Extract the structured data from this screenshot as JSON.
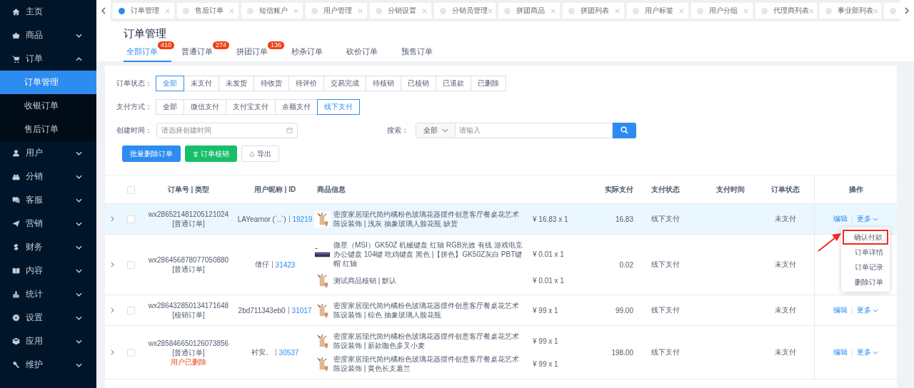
{
  "sidebar": {
    "items": [
      {
        "label": "主页",
        "kind": "link"
      },
      {
        "label": "商品",
        "kind": "group",
        "expanded": false
      },
      {
        "label": "订单",
        "kind": "group",
        "expanded": true,
        "children": [
          {
            "label": "订单管理",
            "selected": true
          },
          {
            "label": "收银订单",
            "selected": false
          },
          {
            "label": "售后订单",
            "selected": false
          }
        ]
      },
      {
        "label": "用户",
        "kind": "group",
        "expanded": false
      },
      {
        "label": "分销",
        "kind": "group",
        "expanded": false
      },
      {
        "label": "客服",
        "kind": "group",
        "expanded": false
      },
      {
        "label": "营销",
        "kind": "group",
        "expanded": false
      },
      {
        "label": "财务",
        "kind": "group",
        "expanded": false
      },
      {
        "label": "内容",
        "kind": "group",
        "expanded": false
      },
      {
        "label": "统计",
        "kind": "group",
        "expanded": false
      },
      {
        "label": "设置",
        "kind": "group",
        "expanded": false
      },
      {
        "label": "应用",
        "kind": "group",
        "expanded": false
      },
      {
        "label": "维护",
        "kind": "group",
        "expanded": false
      }
    ]
  },
  "tab_bar": {
    "tabs": [
      {
        "label": "订单管理",
        "selected": true
      },
      {
        "label": "售后订单",
        "selected": false
      },
      {
        "label": "短信账户",
        "selected": false
      },
      {
        "label": "用户管理",
        "selected": false
      },
      {
        "label": "分销设置",
        "selected": false
      },
      {
        "label": "分销员管理",
        "selected": false
      },
      {
        "label": "拼团商品",
        "selected": false
      },
      {
        "label": "拼团列表",
        "selected": false
      },
      {
        "label": "用户标签",
        "selected": false
      },
      {
        "label": "用户分组",
        "selected": false
      },
      {
        "label": "代理商列表",
        "selected": false
      },
      {
        "label": "事业部列表",
        "selected": false
      }
    ]
  },
  "page_title": "订单管理",
  "order_tabs": [
    {
      "label": "全部订单",
      "badge": "410",
      "selected": true
    },
    {
      "label": "普通订单",
      "badge": "274",
      "selected": false
    },
    {
      "label": "拼团订单",
      "badge": "136",
      "selected": false
    },
    {
      "label": "秒杀订单",
      "selected": false
    },
    {
      "label": "砍价订单",
      "selected": false
    },
    {
      "label": "预售订单",
      "selected": false
    }
  ],
  "filters": {
    "order_status": {
      "label": "订单状态：",
      "options": [
        {
          "label": "全部",
          "selected": true
        },
        {
          "label": "未支付",
          "selected": false
        },
        {
          "label": "未发货",
          "selected": false
        },
        {
          "label": "待收货",
          "selected": false
        },
        {
          "label": "待评价",
          "selected": false
        },
        {
          "label": "交易完成",
          "selected": false
        },
        {
          "label": "待核销",
          "selected": false
        },
        {
          "label": "已核销",
          "selected": false
        },
        {
          "label": "已退款",
          "selected": false
        },
        {
          "label": "已删除",
          "selected": false
        }
      ]
    },
    "payment": {
      "label": "支付方式：",
      "options": [
        {
          "label": "全部",
          "selected": false
        },
        {
          "label": "微信支付",
          "selected": false
        },
        {
          "label": "支付宝支付",
          "selected": false
        },
        {
          "label": "余额支付",
          "selected": false
        },
        {
          "label": "线下支付",
          "selected": true
        }
      ]
    },
    "created": {
      "label": "创建时间：",
      "placeholder": "请选择创建时间"
    },
    "search": {
      "label": "搜索：",
      "scope": "全部",
      "placeholder": "请输入"
    }
  },
  "actions": [
    {
      "label": "批量删除订单",
      "kind": "primary"
    },
    {
      "label": "订单核销",
      "kind": "success"
    },
    {
      "label": "导出",
      "kind": "plain"
    }
  ],
  "table": {
    "select_all_checked": false,
    "columns": [
      "订单号 | 类型",
      "用户昵称 | ID",
      "商品信息",
      "实际支付",
      "支付状态",
      "支付时间",
      "订单状态",
      "操作"
    ],
    "rows": [
      {
        "order_no": "wx286521481205121024",
        "type": "[普通订单]",
        "user": "LAYearnor (ˊ..ˋ)",
        "user_id": "19219",
        "items": [
          {
            "name": "密度家居现代简约橘粉色玻璃花器摆件创意客厅餐桌花艺术陈设装饰 | 浅灰 抽象玻璃人脸花瓶 缺货",
            "price": "¥ 16.83 x 1",
            "kind": "vase"
          }
        ],
        "paid": "16.83",
        "pay_status": "线下支付",
        "order_status": "未支付",
        "checked": false,
        "highlighted": true,
        "edit": "编辑",
        "more": "更多",
        "menu": [
          {
            "label": "确认付款",
            "highlighted": true
          },
          {
            "label": "订单详情",
            "highlighted": false
          },
          {
            "label": "订单记录",
            "highlighted": false
          },
          {
            "label": "删除订单",
            "highlighted": false
          }
        ]
      },
      {
        "order_no": "wx286456878077050880",
        "type": "[普通订单]",
        "user": "倩仔",
        "user_id": "31423",
        "items": [
          {
            "name": "微星（MSI）GK50Z 机械键盘 红轴 RGB光效 有线 游戏电竞办公键盘 104键 吃鸡键盘 黑色 |【拼色】GK50Z灰白 PBT键帽 红轴",
            "price": "¥ 0.01 x 1",
            "kind": "keyboard"
          },
          {
            "name": "测试商品核销 | 默认",
            "price": "¥ 0.01 x 1",
            "kind": "vase"
          }
        ],
        "paid": "0.02",
        "pay_status": "线下支付",
        "order_status": "未支付",
        "checked": false,
        "highlighted": false
      },
      {
        "order_no": "wx286432850134171648",
        "type": "[核销订单]",
        "user": "2bd711343eb0",
        "user_id": "31017",
        "items": [
          {
            "name": "密度家居现代简约橘粉色玻璃花器摆件创意客厅餐桌花艺术陈设装饰 | 棕色 抽象玻璃人脸花瓶",
            "price": "¥ 99 x 1",
            "kind": "vase"
          }
        ],
        "paid": "99.00",
        "pay_status": "线下支付",
        "order_status": "未支付",
        "checked": false,
        "highlighted": false,
        "edit": "编辑",
        "more": "更多"
      },
      {
        "order_no": "wx285846650126073856",
        "type": "[普通订单]",
        "note": "用户已删除",
        "user": "衬安。",
        "user_id": "30537",
        "items": [
          {
            "name": "密度家居现代简约橘粉色玻璃花器摆件创意客厅餐桌花艺术陈设装饰 | 新款咖色多叉小麦",
            "price": "¥ 99 x 1",
            "kind": "vase"
          },
          {
            "name": "密度家居现代简约橘粉色玻璃花器摆件创意客厅餐桌花艺术陈设装饰 | 黄色长支蕙兰",
            "price": "¥ 99 x 1",
            "kind": "vase"
          }
        ],
        "paid": "198.00",
        "pay_status": "线下支付",
        "order_status": "未支付",
        "checked": false,
        "highlighted": false,
        "edit": "编辑",
        "more": "更多"
      }
    ]
  }
}
